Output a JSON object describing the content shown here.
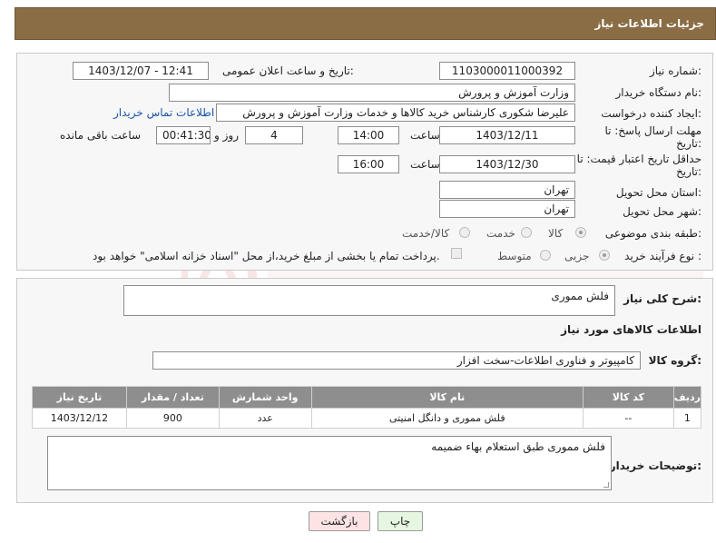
{
  "header": {
    "title": "جزئیات اطلاعات نیاز"
  },
  "form": {
    "need_number_label": "شماره نیاز:",
    "need_number": "1103000011000392",
    "announce_label": "تاریخ و ساعت اعلان عمومی:",
    "announce_value": "1403/12/07 - 12:41",
    "buyer_org_label": "نام دستگاه خریدار:",
    "buyer_org": "وزارت آموزش و پرورش",
    "requester_label": "ایجاد کننده درخواست:",
    "requester": "علیرضا شکوری کارشناس خرید کالاها و خدمات وزارت آموزش و پرورش",
    "contact_link": "اطلاعات تماس خریدار",
    "reply_deadline_label_1": "مهلت ارسال پاسخ: تا",
    "reply_deadline_label_2": "تاریخ:",
    "reply_date": "1403/12/11",
    "time_label": "ساعت",
    "reply_time": "14:00",
    "days_value": "4",
    "days_label": "روز و",
    "remaining_time": "00:41:30",
    "remaining_label": "ساعت باقی مانده",
    "price_valid_label_1": "حداقل تاریخ اعتبار قیمت: تا",
    "price_valid_label_2": "تاریخ:",
    "price_valid_date": "1403/12/30",
    "price_valid_time": "16:00",
    "province_label": "استان محل تحویل:",
    "province": "تهران",
    "city_label": "شهر محل تحویل:",
    "city": "تهران",
    "category_label": "طبقه بندی موضوعی:",
    "category_options": [
      "کالا",
      "خدمت",
      "کالا/خدمت"
    ],
    "purchase_type_label": "نوع فرآیند خرید :",
    "purchase_options": [
      "جزیی",
      "متوسط"
    ],
    "payment_note": "پرداخت تمام یا بخشی از مبلغ خرید،از محل \"اسناد خزانه اسلامی\" خواهد بود."
  },
  "summary": {
    "desc_label": "شرح کلی نیاز:",
    "desc_value": "فلش مموری",
    "items_title": "اطلاعات کالاهای مورد نیاز",
    "group_label": "گروه کالا:",
    "group_value": "کامپیوتر و فناوری اطلاعات-سخت افزار",
    "table": {
      "headers": [
        "ردیف",
        "کد کالا",
        "نام کالا",
        "واحد شمارش",
        "تعداد / مقدار",
        "تاریخ نیاز"
      ],
      "rows": [
        [
          "1",
          "--",
          "فلش مموری و دانگل امنیتی",
          "عدد",
          "900",
          "1403/12/12"
        ]
      ]
    },
    "buyer_notes_label": "توضیحات خریدار:",
    "buyer_notes": "فلش مموری طبق استعلام بهاء ضمیمه"
  },
  "buttons": {
    "print": "چاپ",
    "back": "بازگشت"
  },
  "colors": {
    "header_bg": "#8a6d45",
    "table_header_bg": "#8e8e8e",
    "back_button_bg": "#fde3e3",
    "print_button_bg": "#e6f6e0",
    "link": "#1a55a8"
  }
}
